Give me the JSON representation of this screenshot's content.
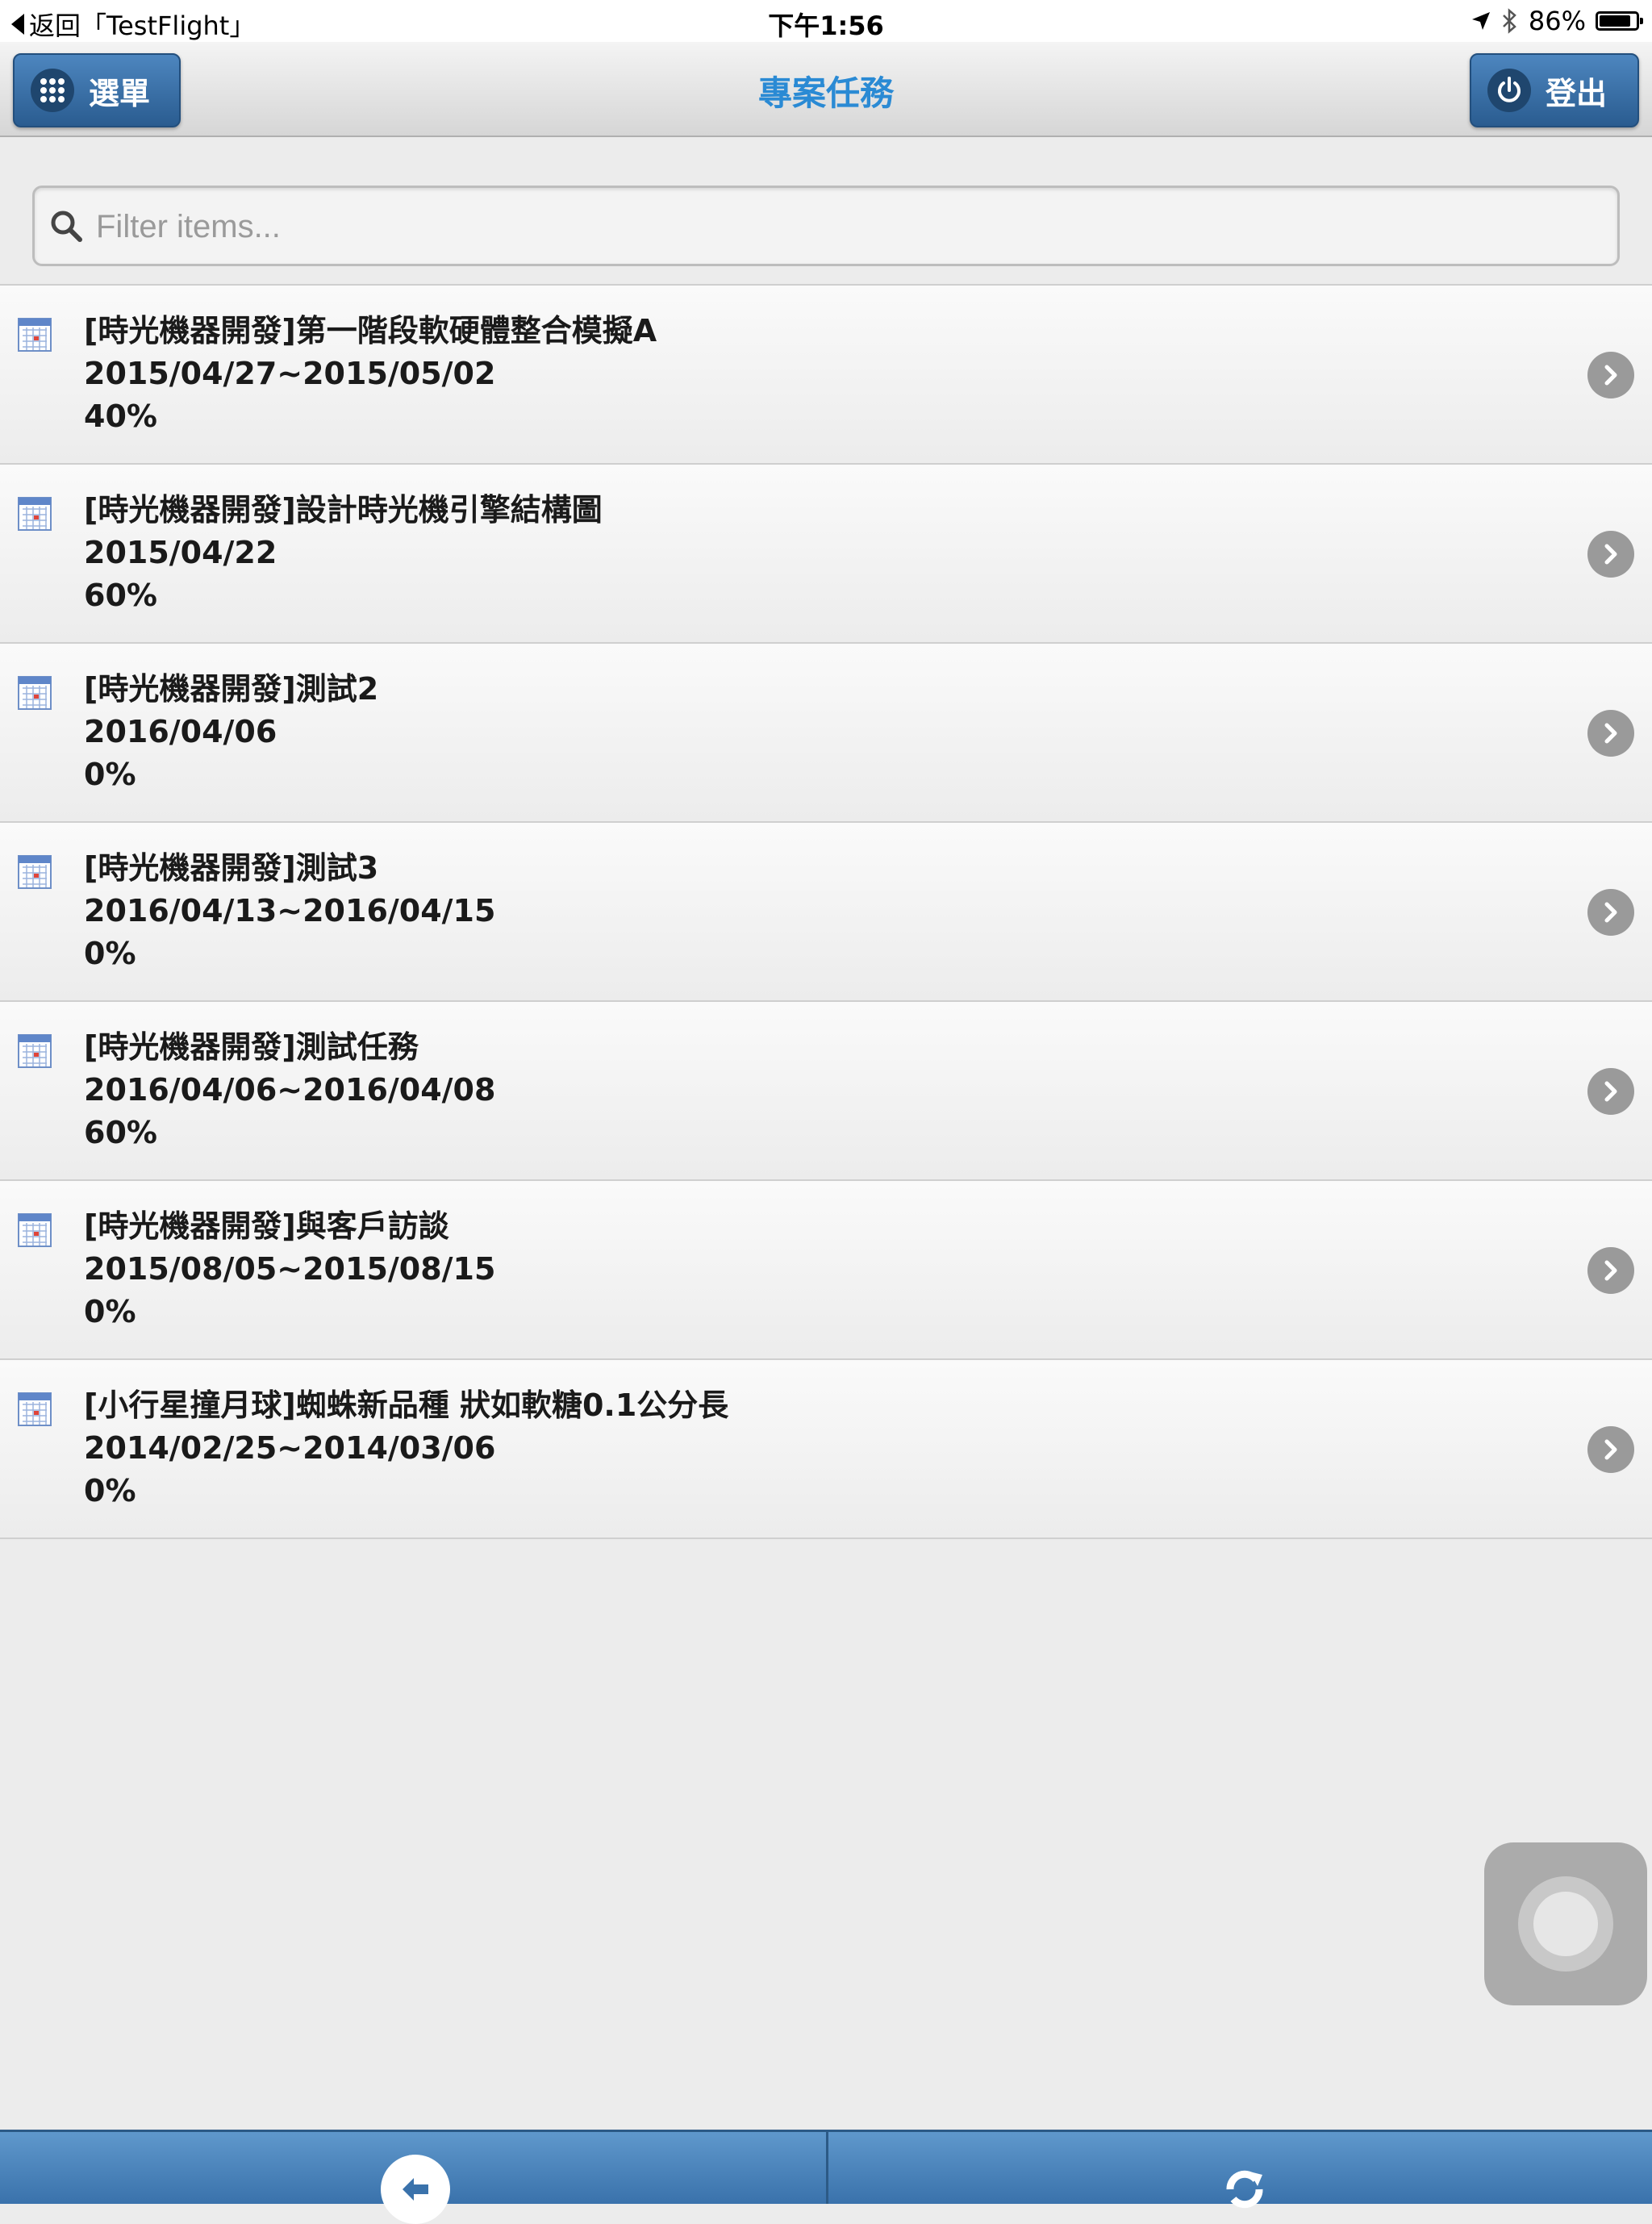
{
  "status_bar": {
    "back_label": "返回「TestFlight」",
    "time": "下午1:56",
    "battery": "86%",
    "battery_level": 0.86
  },
  "header": {
    "title": "專案任務",
    "menu_label": "選單",
    "logout_label": "登出"
  },
  "search": {
    "placeholder": "Filter items...",
    "value": ""
  },
  "tasks": [
    {
      "title": "[時光機器開發]第一階段軟硬體整合模擬A",
      "date": "2015/04/27~2015/05/02",
      "progress": "40%"
    },
    {
      "title": "[時光機器開發]設計時光機引擎結構圖",
      "date": "2015/04/22",
      "progress": "60%"
    },
    {
      "title": "[時光機器開發]測試2",
      "date": "2016/04/06",
      "progress": "0%"
    },
    {
      "title": "[時光機器開發]測試3",
      "date": "2016/04/13~2016/04/15",
      "progress": "0%"
    },
    {
      "title": "[時光機器開發]測試任務",
      "date": "2016/04/06~2016/04/08",
      "progress": "60%"
    },
    {
      "title": "[時光機器開發]與客戶訪談",
      "date": "2015/08/05~2015/08/15",
      "progress": "0%"
    },
    {
      "title": "[小行星撞月球]蜘蛛新品種 狀如軟糖0.1公分長",
      "date": "2014/02/25~2014/03/06",
      "progress": "0%"
    }
  ],
  "colors": {
    "title_blue": "#2a8ad4",
    "button_blue": "#3a6fa5",
    "footer_blue": "#4a84bd"
  },
  "icons": {
    "menu": "grid-icon",
    "logout": "power-icon",
    "search": "search-icon",
    "task": "calendar-icon",
    "row_action": "chevron-right-icon",
    "footer_left": "back-arrow-icon",
    "footer_right": "refresh-icon"
  }
}
